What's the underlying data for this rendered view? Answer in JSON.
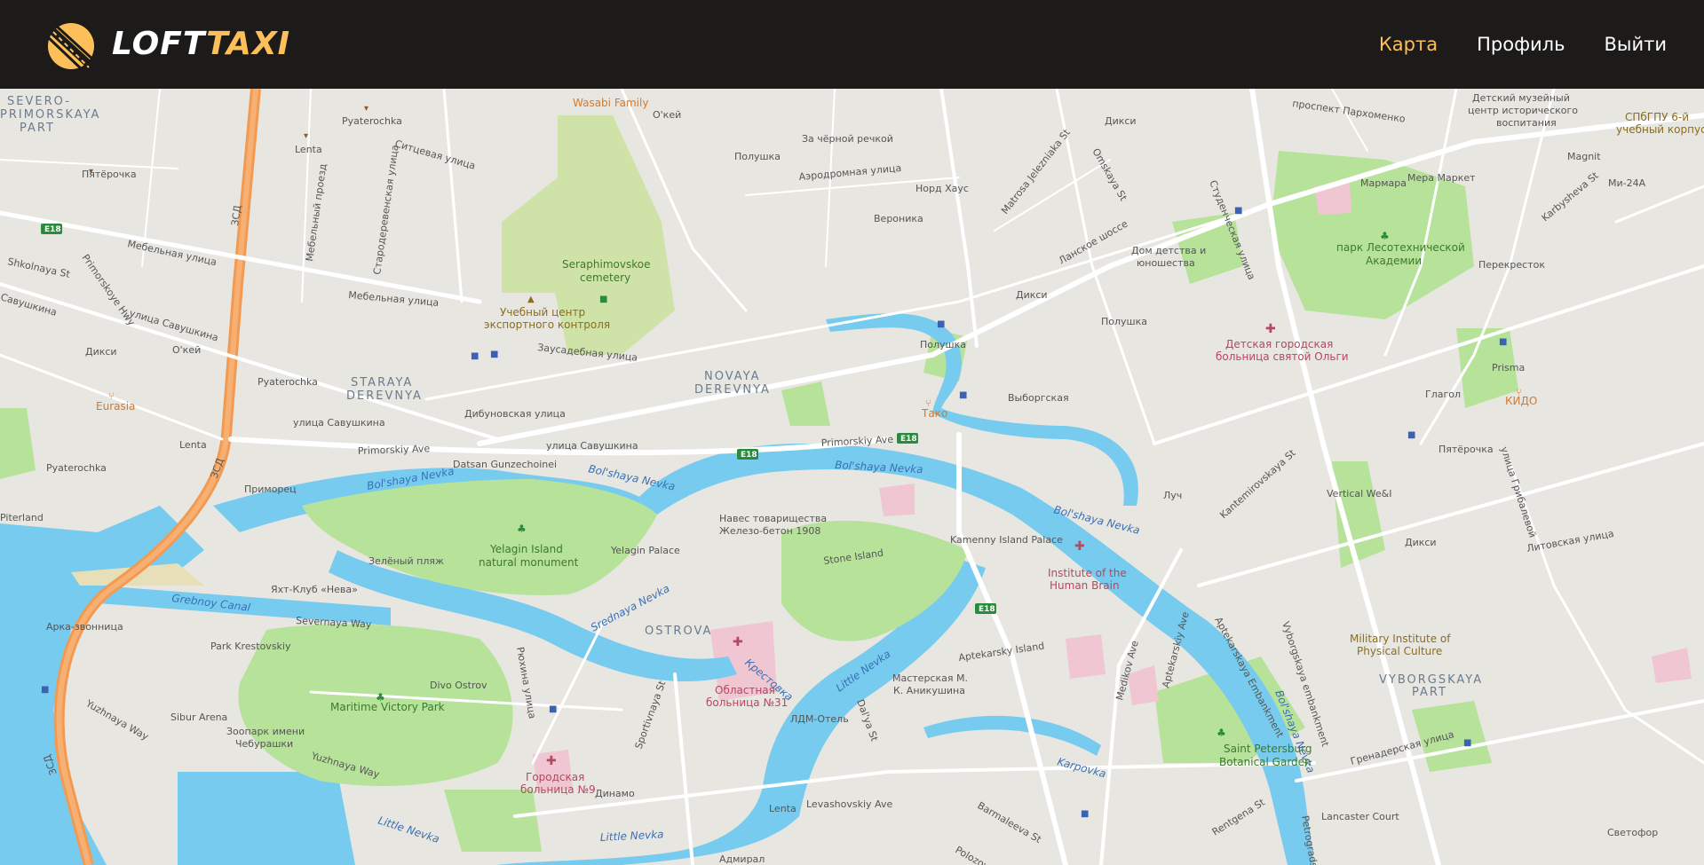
{
  "app": {
    "logo": {
      "part1": "LOFT",
      "part2": "TAXI"
    }
  },
  "nav": {
    "items": [
      {
        "label": "Карта",
        "active": true
      },
      {
        "label": "Профиль",
        "active": false
      },
      {
        "label": "Выйти",
        "active": false
      }
    ]
  },
  "colors": {
    "header_bg": "#1c1b1a",
    "accent": "#fdbf5a",
    "water": "#76cbef",
    "park": "#b6e29a",
    "land": "#e8e6e1",
    "motorway": "#f39a52"
  },
  "map": {
    "areas": {
      "severo": "SEVERO-",
      "primorskaya": "PRIMORSKAYA",
      "part1": "PART",
      "staraya": "STARAYA",
      "derevnya1": "DEREVNYA",
      "novaya": "NOVAYA",
      "derevnya2": "DEREVNYA",
      "ostrova": "OSTROVA",
      "vyborgskaya": "VYBORGSKAYA",
      "part2": "PART"
    },
    "water": {
      "bolshaya_nevka_1": "Bol'shaya Nevka",
      "bolshaya_nevka_2": "Bol'shaya Nevka",
      "bolshaya_nevka_3": "Bol'shaya Nevka",
      "bolshaya_nevka_4": "Bol'shaya Nevka",
      "bolshaya_nevka_5": "Bol'shaya Nevka",
      "srednaya_nevka": "Srednaya Nevka",
      "grebnoy_canal": "Grebnoy Canal",
      "little_nevka_1": "Little Nevka",
      "little_nevka_2": "Little Nevka",
      "little_nevka_3": "Little Nevka",
      "krestovka": "Крестовка",
      "karpovka": "Karpovka"
    },
    "parks": {
      "seraphimovskoe": "Seraphimovskoe",
      "cemetery": "cemetery",
      "yelagin_island": "Yelagin Island",
      "natural_monument": "natural monument",
      "lesotech_1": "парк Лесотехнической",
      "lesotech_2": "Академии",
      "maritime": "Maritime Victory Park",
      "botanical_1": "Saint Petersburg",
      "botanical_2": "Botanical Garden"
    },
    "streets": {
      "mebelnaya_1": "Мебельная улица",
      "mebelnaya_2": "Мебельная улица",
      "mebelny_proezd": "Мебельный проезд",
      "staroderevenskaya": "Стародеревенская улица",
      "sitsevaya": "Ситцевая улица",
      "shkolnaya": "Shkolnaya St",
      "primorskoye_hwy": "Primorskoye Hwy",
      "savushkina_1": "улица Савушкина",
      "savushkina_2": "улица Савушкина",
      "savushkina_3": "улица Савушкина",
      "savushkina_4": "Савушкина",
      "zausadebnaya": "Заусадебная улица",
      "dibunovskaya": "Дибуновская улица",
      "primorskiy_ave_1": "Primorskiy Ave",
      "primorskiy_ave_2": "Primorskiy Ave",
      "aerodromnaya": "Аэродромная улица",
      "matrosa": "Matrosa Jelezniaka St",
      "omskaya": "Omskaya St",
      "lanskoe": "Ланское шоссе",
      "studencheskaya": "Студенческая улица",
      "parkhomenko": "проспект Пархоменко",
      "karbysheva": "Karbysheva St",
      "kantemirovskaya": "Kantemirovskaya St",
      "gribalevoy": "улица Грибалевой",
      "litovskaya": "Литовская улица",
      "grenaderskaya": "Гренадерская улица",
      "severnaya_way": "Severnaya Way",
      "yuzhnaya_way_1": "Yuzhnaya Way",
      "yuzhnaya_way_2": "Yuzhnaya Way",
      "ryukhina": "Рюхина улица",
      "sportivnaya": "Sportivnaya St",
      "dalya": "Dal'ya St",
      "levashovskiy": "Levashovskiy Ave",
      "barmaleeva": "Barmaleeva St",
      "polozova": "Polozova",
      "rentgena": "Rentgena St",
      "medikov": "Medikov Ave",
      "aptekarskiy_ave": "Aptekarskiy Ave",
      "aptekarskaya_emb": "Aptekarskaya Embankment",
      "vyborgskaya_emb": "Vyborgskaya embankment",
      "petrograd": "Petrograds",
      "zsd_1": "ЗСД",
      "zsd_2": "ЗСД",
      "zsd_3": "ЗСД"
    },
    "pois": {
      "wasabi": "Wasabi Family",
      "okey_1": "О'кей",
      "okey_2": "О'кей",
      "pyaterochka_1": "Pyaterochka",
      "pyaterochka_2": "Пятёрочка",
      "pyaterochka_3": "Pyaterochka",
      "pyaterochka_4": "Pyaterochka",
      "pyaterochka_5": "Пятёрочка",
      "lenta_1": "Lenta",
      "lenta_2": "Lenta",
      "lenta_3": "Lenta",
      "dixy_1": "Дикси",
      "dixy_2": "Дикси",
      "dixy_3": "Дикси",
      "dixy_4": "Дикси",
      "polushka_1": "Полушка",
      "polushka_2": "Полушка",
      "polushka_3": "Полушка",
      "za_chernoy": "За чёрной речкой",
      "nord_haus": "Норд Хаус",
      "veronika": "Вероника",
      "dom_detstva_1": "Дом детства и",
      "dom_detstva_2": "юношества",
      "uchebny_1": "Учебный центр",
      "uchebny_2": "экспортного контроля",
      "eurasia": "Eurasia",
      "primorets": "Приморец",
      "datsan": "Datsan Gunzechoinei",
      "takao": "Тако",
      "vyborgskaya_shop": "Выборгская",
      "luch": "Луч",
      "vertical": "Vertical We&I",
      "perekrestok": "Перекресток",
      "glagol": "Глагол",
      "prisma": "Prisma",
      "kido": "КИДО",
      "magnit": "Magnit",
      "marmara": "Мармара",
      "mera": "Мера Маркет",
      "mi24": "Ми-24А",
      "detsky_muz_1": "Детский музейный",
      "detsky_muz_2": "центр исторического",
      "detsky_muz_3": "воспитания",
      "spbgpu_1": "СПбГПУ 6-й",
      "spbgpu_2": "учебный корпус",
      "detskaya_bol_1": "Детская городская",
      "detskaya_bol_2": "больница святой Ольги",
      "zeleny_plyazh": "Зелёный пляж",
      "yelagin_palace": "Yelagin Palace",
      "naves_1": "Навес товарищества",
      "naves_2": "Железо-бетон 1908",
      "stone_island": "Stone Island",
      "kamenny_palace": "Kamenny Island Palace",
      "institute_1": "Institute of the",
      "institute_2": "Human Brain",
      "yacht_club": "Яхт-Клуб «Нева»",
      "arka": "Арка-звонница",
      "park_krestovsky": "Park Krestovskiy",
      "divo_ostrov": "Divo Ostrov",
      "sibur": "Sibur Arena",
      "zoopark_1": "Зоопарк имени",
      "zoopark_2": "Чебурашки",
      "oblastnaya_1": "Областная",
      "oblastnaya_2": "больница №31",
      "ldm": "ЛДМ-Отель",
      "masterskaya_1": "Мастерская М.",
      "masterskaya_2": "К. Аникушина",
      "aptekarsky_island": "Aptekarsky Island",
      "gorodskaya_1": "Городская",
      "gorodskaya_2": "больница №9",
      "dinamo": "Динамо",
      "admiral": "Адмирал",
      "military_1": "Military Institute of",
      "military_2": "Physical Culture",
      "lancaster": "Lancaster Court",
      "svetofor": "Светофор",
      "piterland": "Piterland",
      "pyaterochka_6": "Пятерочка",
      "pyaterochka_7": "Пятёрочка"
    },
    "shields": {
      "e18_1": "E18",
      "e18_2": "E18",
      "e18_3": "E18",
      "e18_4": "E18"
    }
  }
}
